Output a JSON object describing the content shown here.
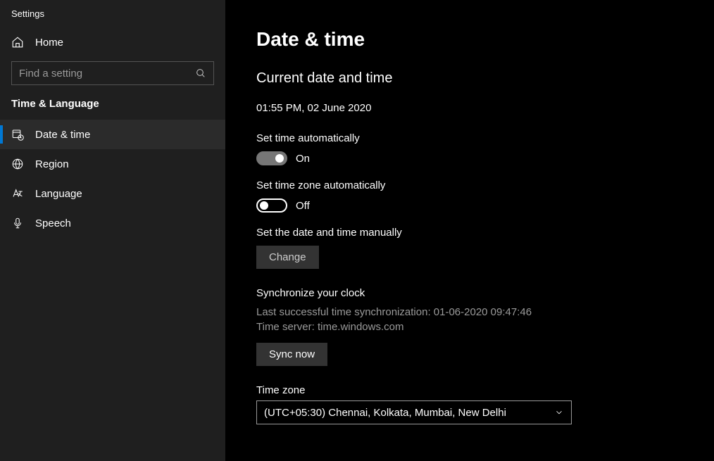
{
  "app_title": "Settings",
  "home_label": "Home",
  "search_placeholder": "Find a setting",
  "category_heading": "Time & Language",
  "nav": [
    {
      "label": "Date & time"
    },
    {
      "label": "Region"
    },
    {
      "label": "Language"
    },
    {
      "label": "Speech"
    }
  ],
  "page_title": "Date & time",
  "current": {
    "heading": "Current date and time",
    "value": "01:55 PM, 02 June 2020"
  },
  "set_time_auto": {
    "label": "Set time automatically",
    "state": "On"
  },
  "set_tz_auto": {
    "label": "Set time zone automatically",
    "state": "Off"
  },
  "manual": {
    "label": "Set the date and time manually",
    "button": "Change"
  },
  "sync": {
    "heading": "Synchronize your clock",
    "last_line": "Last successful time synchronization: 01-06-2020 09:47:46",
    "server_line": "Time server: time.windows.com",
    "button": "Sync now"
  },
  "timezone": {
    "label": "Time zone",
    "value": "(UTC+05:30) Chennai, Kolkata, Mumbai, New Delhi"
  }
}
